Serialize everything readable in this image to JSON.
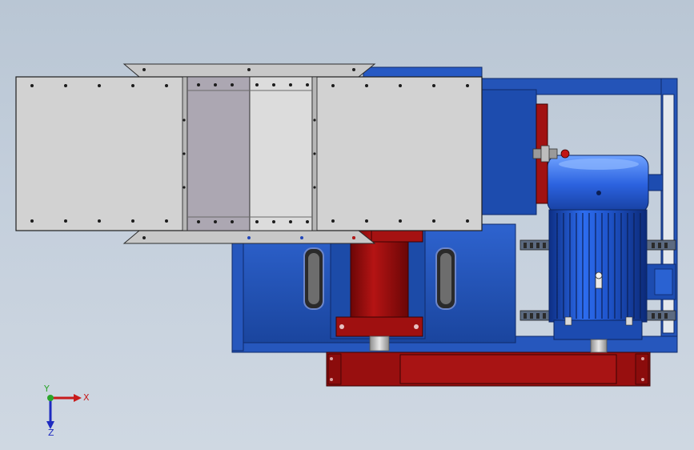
{
  "scene": {
    "colors": {
      "background_top": "#b9c6d4",
      "background_bottom": "#cfd8e2",
      "frame_blue": "#1f4fb0",
      "frame_blue_dark": "#15388a",
      "frame_blue_light": "#3a6fd8",
      "motor_blue": "#1e5bd6",
      "red_part": "#9a0f0f",
      "red_dark": "#6e0707",
      "panel_gray": "#cfcfcf",
      "panel_gray_dark": "#a9a6b0",
      "panel_gray_light": "#dcdcdc"
    }
  },
  "triad": {
    "x_label": "X",
    "y_label": "Y",
    "z_label": "Z"
  }
}
